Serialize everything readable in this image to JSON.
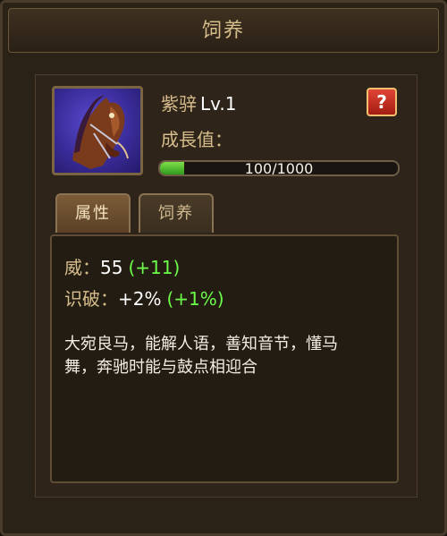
{
  "header": {
    "title": "饲养"
  },
  "mount": {
    "name": "紫骍",
    "level": "Lv.1",
    "growth_label": "成長值：",
    "help_label": "?",
    "progress": {
      "current": 100,
      "max": 1000,
      "text": "100/1000"
    }
  },
  "tabs": [
    {
      "label": "属性",
      "active": true
    },
    {
      "label": "饲养",
      "active": false
    }
  ],
  "stats": [
    {
      "label": "威：",
      "value": "55",
      "bonus": "(+11)"
    },
    {
      "label": "识破：",
      "value": "+2%",
      "bonus": "(+1%)"
    }
  ],
  "description_lines": [
    "大宛良马，能解人语，善知音节，懂马",
    "舞，奔驰时能与鼓点相迎合"
  ],
  "colors": {
    "accent_gold": "#d7bd8b",
    "bonus_green": "#6cff4a",
    "help_red": "#c2281a",
    "bar_green": "#5cc63a"
  }
}
